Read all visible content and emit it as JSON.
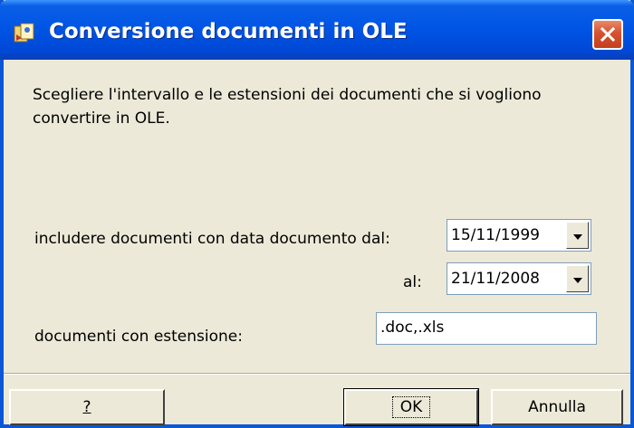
{
  "window": {
    "title": "Conversione documenti in OLE",
    "icon": "app-icon",
    "close_icon": "close-icon"
  },
  "message": "Scegliere l'intervallo e le estensioni dei documenti che si vogliono convertire in OLE.",
  "form": {
    "date_from_label": "includere documenti con data documento dal:",
    "date_from_value": "15/11/1999",
    "date_to_label": "al:",
    "date_to_value": "21/11/2008",
    "extension_label": "documenti con estensione:",
    "extension_value": ".doc,.xls"
  },
  "buttons": {
    "help_label": "?",
    "ok_label": "OK",
    "cancel_label": "Annulla"
  },
  "colors": {
    "titlebar": "#0055e5",
    "close_button": "#d6512e",
    "dialog_background": "#ece9d8"
  }
}
